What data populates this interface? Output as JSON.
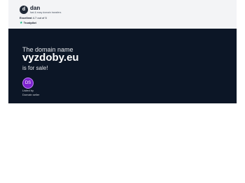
{
  "header": {
    "logo_letter": "d",
    "brand": "dan",
    "tagline": "fast & easy domain transfers",
    "rating_label": "Excellent",
    "rating_value": "4.7 out of 5",
    "trustpilot": "Trustpilot"
  },
  "hero": {
    "eyebrow": "The domain name",
    "domain": "vyzdoby.eu",
    "forsale": "is for sale!",
    "avatar_initials": "DS",
    "listed_by_line1": "Listed by",
    "listed_by_line2": "Domain seller"
  },
  "colors": {
    "hero_background": "#0c1626",
    "header_background": "#f3f4f6",
    "avatar_background": "#7e22ce",
    "trustpilot_star": "#00b67a"
  }
}
